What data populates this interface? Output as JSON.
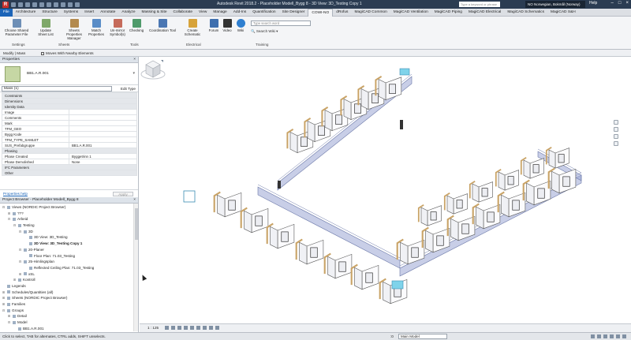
{
  "window": {
    "title": "Autodesk Revit 2018.2 -    Placeholder Modell_Bygg 8 - 3D View: 3D_Testing Copy 1",
    "search_placeholder": "Type a keyword or phrase",
    "user": "NO Norwegian, Bokmål (Norway)",
    "help": "Help"
  },
  "tabs": [
    "File",
    "Architecture",
    "Structure",
    "Systems",
    "Insert",
    "Annotate",
    "Analyze",
    "Massing & Site",
    "Collaborate",
    "View",
    "Manage",
    "Add-Ins",
    "Quantification",
    "Site Designer",
    "COWI-NO",
    "dRofus",
    "MagiCAD Common",
    "MagiCAD Ventilation",
    "MagiCAD Piping",
    "MagiCAD Electrical",
    "MagiCAD Schematics",
    "MagiCAD S&H"
  ],
  "active_tab": "COWI-NO",
  "ribbon": {
    "buttons": [
      {
        "label": "Choose Shared Parameter File",
        "icon": "shared-parameter-icon"
      },
      {
        "label": "Update Sheet List",
        "icon": "sheet-list-icon"
      },
      {
        "label": "Sheets Properties Manager",
        "icon": "sheets-manager-icon"
      },
      {
        "label": "Match Properties",
        "icon": "match-properties-icon"
      },
      {
        "label": "Un-mirror Symbol(s)",
        "icon": "unmirror-icon"
      },
      {
        "label": "Checking",
        "icon": "checking-icon"
      },
      {
        "label": "Coordination Tool",
        "icon": "coordination-icon"
      },
      {
        "label": "Create Schematic",
        "icon": "schematic-icon"
      },
      {
        "label": "Forum",
        "icon": "forum-icon"
      },
      {
        "label": "Video",
        "icon": "video-icon"
      },
      {
        "label": "Wiki",
        "icon": "wiki-icon"
      }
    ],
    "wiki_search_placeholder": "Type search word",
    "wiki_search_button": "Search Wiki",
    "panels": [
      "Settings",
      "Sheets",
      "Tools",
      "Electrical",
      "Training"
    ]
  },
  "options_bar": {
    "context": "Modify | Mass",
    "checkbox_label": "Moves With Nearby Elements"
  },
  "properties": {
    "header": "Properties",
    "type_name": "BB1.A.R.001",
    "selector": "Mass (1)",
    "edit_type": "Edit Type",
    "rows": [
      {
        "name": "Constraints",
        "value": "",
        "group": true
      },
      {
        "name": "Dimensions",
        "value": "",
        "group": true
      },
      {
        "name": "Identity Data",
        "value": "",
        "group": true
      },
      {
        "name": "Image",
        "value": "",
        "group": false
      },
      {
        "name": "Comments",
        "value": "",
        "group": false
      },
      {
        "name": "Mark",
        "value": "",
        "group": false
      },
      {
        "name": "TFM_GEO",
        "value": "",
        "group": false
      },
      {
        "name": "Bygg Kode",
        "value": "",
        "group": false
      },
      {
        "name": "TFM_TYPE_SAMLET",
        "value": "",
        "group": false
      },
      {
        "name": "SUS_Prefabgruppe",
        "value": "BB1.A.R.001",
        "group": false
      },
      {
        "name": "Phasing",
        "value": "",
        "group": true
      },
      {
        "name": "Phase Created",
        "value": "Byggetrinn 1",
        "group": false
      },
      {
        "name": "Phase Demolished",
        "value": "None",
        "group": false
      },
      {
        "name": "IFC Parameters",
        "value": "",
        "group": true
      },
      {
        "name": "Other",
        "value": "",
        "group": true
      }
    ],
    "help_link": "Properties help",
    "apply": "Apply"
  },
  "project_browser": {
    "header": "Project Browser - Placeholder Modell_Bygg 8",
    "nodes": [
      {
        "label": "Views (NORDIC Project Browser)",
        "depth": 0,
        "toggle": "−"
      },
      {
        "label": "???",
        "depth": 1,
        "toggle": "+"
      },
      {
        "label": "Arbeid",
        "depth": 1,
        "toggle": "−"
      },
      {
        "label": "Testing",
        "depth": 2,
        "toggle": "−"
      },
      {
        "label": "3D",
        "depth": 3,
        "toggle": "−"
      },
      {
        "label": "3D View: 3D_Testing",
        "depth": 4,
        "toggle": "",
        "bold": false
      },
      {
        "label": "3D View: 3D_Testing Copy 1",
        "depth": 4,
        "toggle": "",
        "bold": true
      },
      {
        "label": "20-Planer",
        "depth": 3,
        "toggle": "−"
      },
      {
        "label": "Floor Plan: 71.03_Testing",
        "depth": 4,
        "toggle": ""
      },
      {
        "label": "25-Himlingsplan",
        "depth": 3,
        "toggle": "−"
      },
      {
        "label": "Reflected Ceiling Plan: 71.03_Testing",
        "depth": 4,
        "toggle": ""
      },
      {
        "label": "xSL",
        "depth": 3,
        "toggle": "+"
      },
      {
        "label": "Kontroll",
        "depth": 2,
        "toggle": "+"
      },
      {
        "label": "Legends",
        "depth": 0,
        "toggle": ""
      },
      {
        "label": "Schedules/Quantities (all)",
        "depth": 0,
        "toggle": "+"
      },
      {
        "label": "Sheets (NORDIC Project Browser)",
        "depth": 0,
        "toggle": "+"
      },
      {
        "label": "Families",
        "depth": 0,
        "toggle": "+"
      },
      {
        "label": "Groups",
        "depth": 0,
        "toggle": "−"
      },
      {
        "label": "Detail",
        "depth": 1,
        "toggle": "+"
      },
      {
        "label": "Model",
        "depth": 1,
        "toggle": "−"
      },
      {
        "label": "BB1.A.R.001",
        "depth": 2,
        "toggle": ""
      },
      {
        "label": "BB1.A.R.001",
        "depth": 2,
        "toggle": ""
      }
    ]
  },
  "view_control": {
    "scale": "1 : 125"
  },
  "status": {
    "message": "Click to select, TAB for alternates, CTRL adds, SHIFT unselects.",
    "zero": ":0",
    "model": "Main Model"
  },
  "colors": {
    "titlebar": "#2b3c52",
    "file_tab": "#1b64b8",
    "corridor": "#9aa6d3",
    "wall_tan": "#c9a366",
    "highlight_cyan": "#7fd3ea"
  }
}
